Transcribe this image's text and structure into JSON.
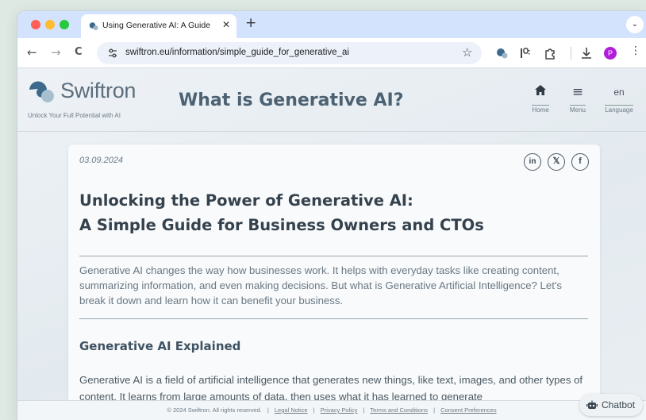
{
  "browser": {
    "tab": {
      "title": "Using Generative AI: A Guide",
      "close": "✕"
    },
    "new_tab": "+",
    "tab_dropdown": "⌄",
    "nav": {
      "back": "←",
      "forward": "→",
      "reload": "C"
    },
    "url": "swiftron.eu/information/simple_guide_for_generative_ai",
    "bookmark": "☆",
    "profile_initial": "P",
    "menu": "⋮"
  },
  "site": {
    "logo_text": "Swiftron",
    "tagline": "Unlock Your Full Potential with AI",
    "page_heading": "What is Generative AI?",
    "nav": {
      "home_label": "Home",
      "menu_icon": "≡",
      "menu_label": "Menu",
      "language_value": "en",
      "language_label": "Language"
    }
  },
  "article": {
    "date": "03.09.2024",
    "share": {
      "linkedin": "in",
      "x": "𝕏",
      "facebook": "f"
    },
    "title_line1": "Unlocking the Power of Generative AI:",
    "title_line2": "A Simple Guide for Business Owners and CTOs",
    "intro": "Generative AI changes the way how businesses work. It helps with everyday tasks like creating content, summarizing information, and even making decisions. But what is Generative Artificial Intelligence? Let's break it down and learn how it can benefit your business.",
    "section_heading": "Generative AI Explained",
    "section_body": "Generative AI is a field of artificial intelligence that generates new things, like text, images, and other types of content. It learns from large amounts of data, then uses what it has learned to generate"
  },
  "footer": {
    "copyright": "© 2024 Swiftron. All rights reserved.",
    "separator": "|",
    "links": {
      "legal_notice": "Legal Notice",
      "privacy_policy": "Privacy Policy",
      "terms": "Terms and Conditions",
      "consent": "Consent Preferences"
    }
  },
  "chatbot": {
    "label": "Chatbot"
  },
  "colors": {
    "tab_strip": "#d3e3fd",
    "heading": "#4c6272",
    "profile": "#b21ddb"
  }
}
